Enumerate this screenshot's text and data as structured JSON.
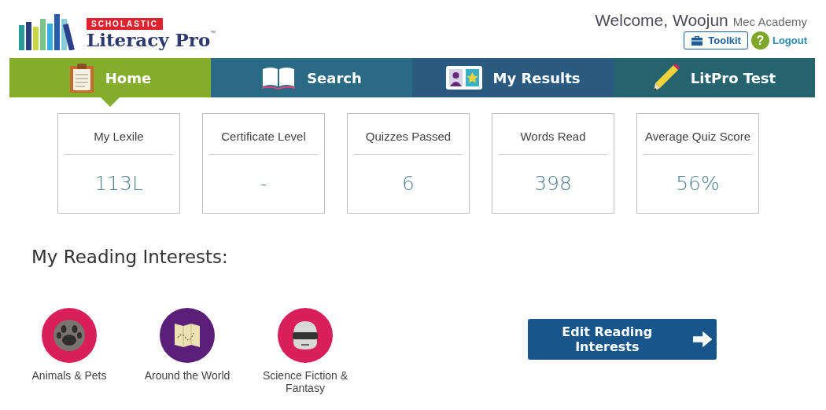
{
  "logo": {
    "brand": "SCHOLASTIC",
    "product": "Literacy Pro",
    "trademark": "™"
  },
  "user": {
    "welcome": "Welcome, Woojun",
    "school": "Mec Academy"
  },
  "header_buttons": {
    "toolkit": "Toolkit",
    "help": "?",
    "logout": "Logout"
  },
  "tabs": [
    {
      "label": "Home",
      "kind": "clipboard",
      "selected": true
    },
    {
      "label": "Search",
      "kind": "book",
      "selected": false
    },
    {
      "label": "My Results",
      "kind": "results",
      "selected": false
    },
    {
      "label": "LitPro Test",
      "kind": "pencil",
      "selected": false
    }
  ],
  "stats": [
    {
      "label": "My Lexile",
      "value": "113L"
    },
    {
      "label": "Certificate Level",
      "value": "-"
    },
    {
      "label": "Quizzes Passed",
      "value": "6"
    },
    {
      "label": "Words Read",
      "value": "398"
    },
    {
      "label": "Average Quiz Score",
      "value": "56%"
    }
  ],
  "interests": {
    "title": "My Reading Interests:",
    "items": [
      {
        "label": "Animals & Pets",
        "kind": "paw",
        "color": "#d81f5c"
      },
      {
        "label": "Around the World",
        "kind": "map",
        "color": "#5a1f78"
      },
      {
        "label": "Science Fiction & Fantasy",
        "kind": "robot",
        "color": "#d81f5c"
      }
    ],
    "edit_button": "Edit Reading Interests"
  }
}
